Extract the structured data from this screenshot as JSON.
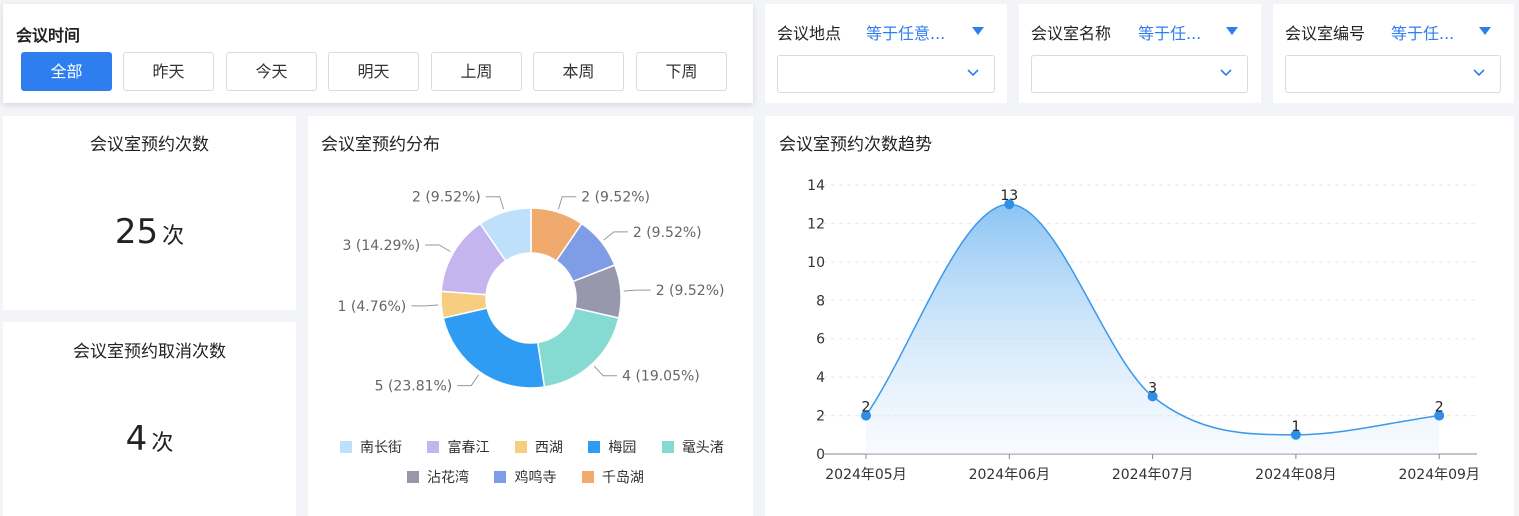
{
  "time_filter": {
    "title": "会议时间",
    "buttons": [
      {
        "label": "全部",
        "active": true
      },
      {
        "label": "昨天",
        "active": false
      },
      {
        "label": "今天",
        "active": false
      },
      {
        "label": "明天",
        "active": false
      },
      {
        "label": "上周",
        "active": false
      },
      {
        "label": "本周",
        "active": false
      },
      {
        "label": "下周",
        "active": false
      }
    ]
  },
  "filters": [
    {
      "label": "会议地点",
      "operator": "等于任意..."
    },
    {
      "label": "会议室名称",
      "operator": "等于任..."
    },
    {
      "label": "会议室编号",
      "operator": "等于任..."
    }
  ],
  "stats": {
    "bookings": {
      "title": "会议室预约次数",
      "value": "25",
      "unit": "次"
    },
    "cancellations": {
      "title": "会议室预约取消次数",
      "value": "4",
      "unit": "次"
    }
  },
  "colors": {
    "accent": "#2f7ef0",
    "line": "#3b98ea"
  },
  "chart_data": [
    {
      "type": "pie",
      "title": "会议室预约分布",
      "donut": true,
      "legend_position": "bottom",
      "slices": [
        {
          "name": "千岛湖",
          "value": 2,
          "label": "2 (9.52%)",
          "color": "#f0aa6e"
        },
        {
          "name": "鸡鸣寺",
          "value": 2,
          "label": "2 (9.52%)",
          "color": "#7f9de6"
        },
        {
          "name": "沾花湾",
          "value": 2,
          "label": "2 (9.52%)",
          "color": "#9898ad"
        },
        {
          "name": "鼋头渚",
          "value": 4,
          "label": "4 (19.05%)",
          "color": "#85dad2"
        },
        {
          "name": "梅园",
          "value": 5,
          "label": "5 (23.81%)",
          "color": "#2f9cf3"
        },
        {
          "name": "西湖",
          "value": 1,
          "label": "1 (4.76%)",
          "color": "#f7cd80"
        },
        {
          "name": "富春江",
          "value": 3,
          "label": "3 (14.29%)",
          "color": "#c4b5ee"
        },
        {
          "name": "南长街",
          "value": 2,
          "label": "2 (9.52%)",
          "color": "#bfe0fb"
        }
      ],
      "legend_order": [
        "南长街",
        "富春江",
        "西湖",
        "梅园",
        "鼋头渚",
        "沾花湾",
        "鸡鸣寺",
        "千岛湖"
      ]
    },
    {
      "type": "area",
      "title": "会议室预约次数趋势",
      "categories": [
        "2024年05月",
        "2024年06月",
        "2024年07月",
        "2024年08月",
        "2024年09月"
      ],
      "values": [
        2,
        13,
        3,
        1,
        2
      ],
      "ylim": [
        0,
        14
      ],
      "yticks": [
        0,
        2,
        4,
        6,
        8,
        10,
        12,
        14
      ],
      "grid": true,
      "smooth": true
    }
  ]
}
